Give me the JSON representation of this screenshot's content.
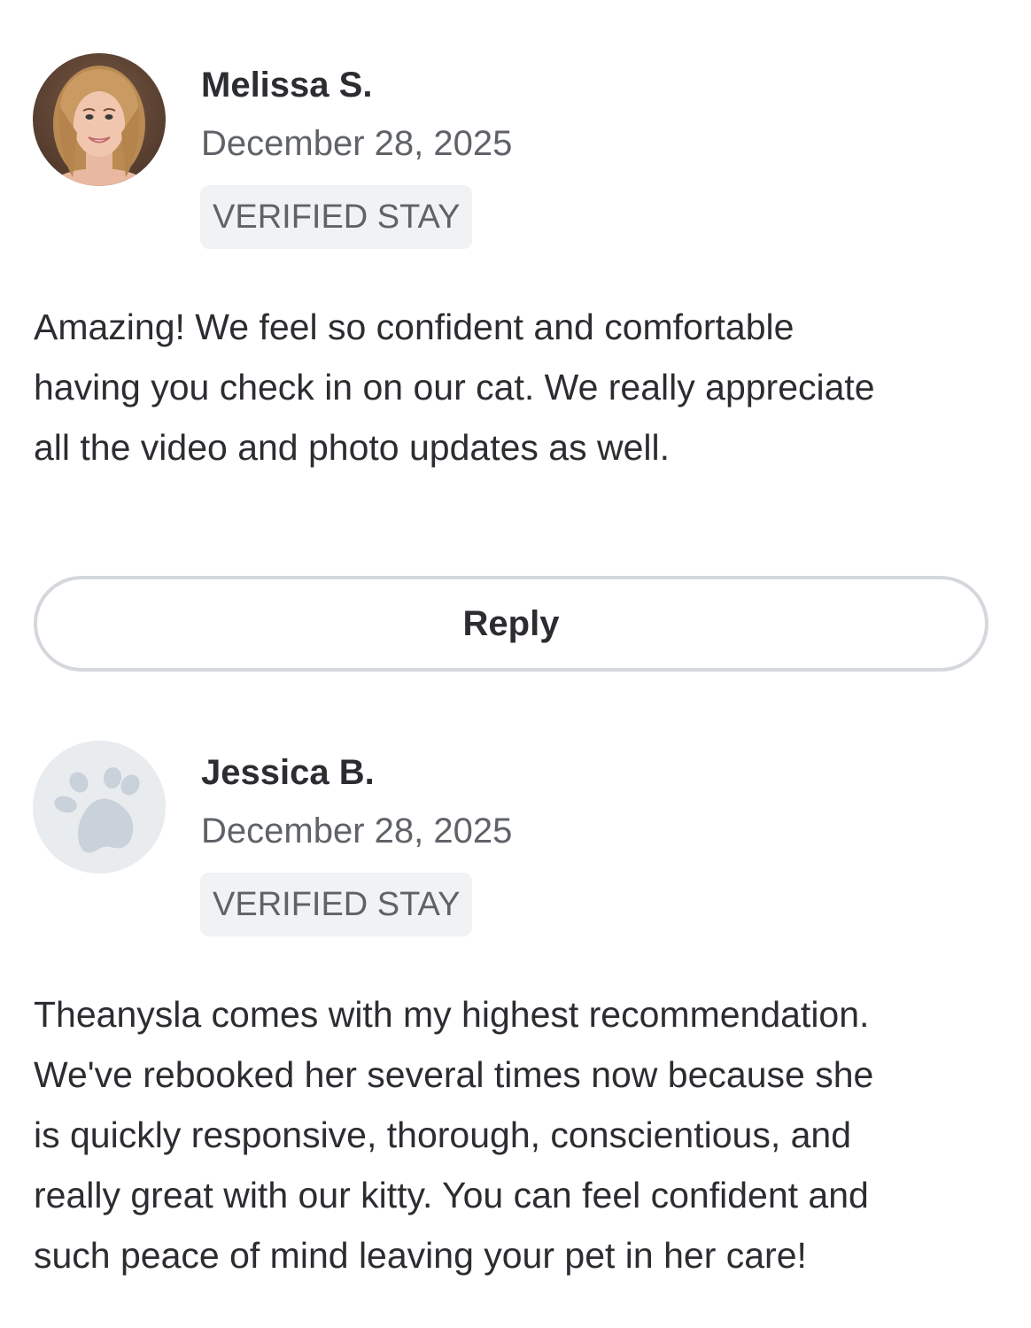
{
  "reviews": [
    {
      "name": "Melissa S.",
      "date": "December 28, 2025",
      "badge": "VERIFIED STAY",
      "avatar": "profile-photo",
      "text_lines": [
        "Amazing! We feel so confident and comfortable",
        "having you check in on our cat. We really appreciate",
        "all the video and photo updates as well."
      ]
    },
    {
      "name": "Jessica B.",
      "date": "December 28, 2025",
      "badge": "VERIFIED STAY",
      "avatar": "paw-icon",
      "text_lines": [
        "Theanysla comes with my highest recommendation.",
        "We've rebooked her several times now because she",
        "is quickly responsive, thorough, conscientious, and",
        "really great with our kitty. You can feel confident and",
        "such peace of mind leaving your pet in her care!"
      ]
    }
  ],
  "reply_button": {
    "label": "Reply"
  },
  "colors": {
    "text": "#2b2d31",
    "muted": "#5f6368",
    "badge_bg": "#f1f2f4",
    "button_border": "#d4d7dc",
    "paw_bg": "#e9ecef",
    "paw": "#c9d1da"
  }
}
